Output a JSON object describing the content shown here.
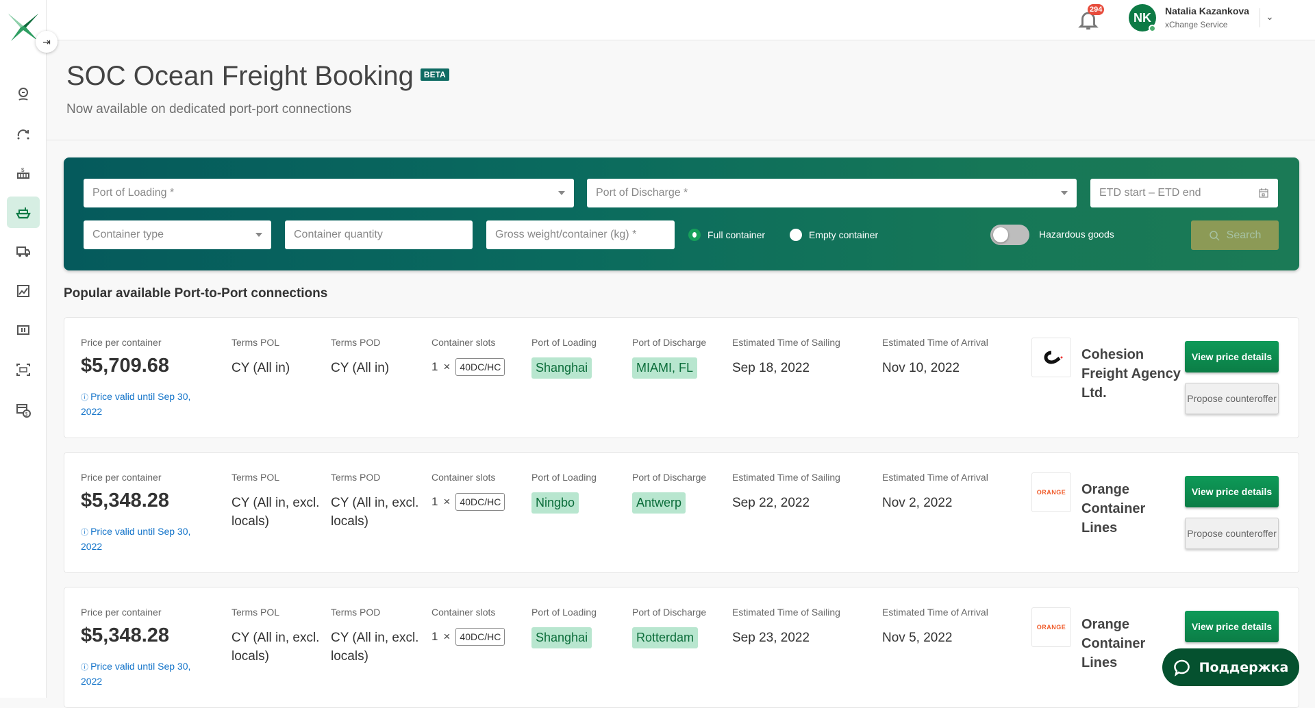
{
  "colors": {
    "brand": "#0d7a45",
    "panel_start": "#055a5c",
    "panel_end": "#1b7a56",
    "chip": "#b8e6cf",
    "link": "#1273c9"
  },
  "sidebar": {
    "items": [
      {
        "icon": "support-agent-icon"
      },
      {
        "icon": "route-icon"
      },
      {
        "icon": "container-price-icon"
      },
      {
        "icon": "ship-icon",
        "active": true
      },
      {
        "icon": "truck-icon"
      },
      {
        "icon": "analytics-icon"
      },
      {
        "icon": "container-icon"
      },
      {
        "icon": "container-scan-icon"
      },
      {
        "icon": "billing-icon"
      }
    ]
  },
  "header": {
    "notifications": "294",
    "user_initials": "NK",
    "user_name": "Natalia Kazankova",
    "user_role": "xChange Service"
  },
  "page": {
    "title": "SOC Ocean Freight Booking",
    "badge": "BETA",
    "subtitle": "Now available on dedicated port-port connections"
  },
  "search": {
    "port_loading": "Port of Loading *",
    "port_discharge": "Port of Discharge *",
    "etd": "ETD start – ETD end",
    "container_type": "Container type",
    "container_quantity": "Container quantity",
    "gross_weight": "Gross weight/container (kg) *",
    "full_container": "Full container",
    "empty_container": "Empty container",
    "selected": "Full container",
    "hazardous": "Hazardous goods",
    "hazardous_on": false,
    "search_label": "Search"
  },
  "section_title": "Popular available Port-to-Port connections",
  "labels": {
    "price": "Price per container",
    "terms_pol": "Terms POL",
    "terms_pod": "Terms POD",
    "slots": "Container slots",
    "pol": "Port of Loading",
    "pod": "Port of Discharge",
    "ets": "Estimated Time of Sailing",
    "eta": "Estimated Time of Arrival",
    "view": "View price details",
    "propose": "Propose counteroffer",
    "times": "×"
  },
  "offers": [
    {
      "price": "$5,709.68",
      "valid": "Price valid until Sep 30, 2022",
      "terms_pol": "CY (All in)",
      "terms_pod": "CY (All in)",
      "qty": "1",
      "ctype": "40DC/HC",
      "pol": "Shanghai",
      "pod": "MIAMI, FL",
      "ets": "Sep 18, 2022",
      "eta": "Nov 10, 2022",
      "carrier": "Cohesion Freight Agency Ltd.",
      "logo": "C",
      "propose": true
    },
    {
      "price": "$5,348.28",
      "valid": "Price valid until Sep 30, 2022",
      "terms_pol": "CY (All in, excl. locals)",
      "terms_pod": "CY (All in, excl. locals)",
      "qty": "1",
      "ctype": "40DC/HC",
      "pol": "Ningbo",
      "pod": "Antwerp",
      "ets": "Sep 22, 2022",
      "eta": "Nov 2, 2022",
      "carrier": "Orange Container Lines",
      "logo": "ORANGE",
      "propose": true
    },
    {
      "price": "$5,348.28",
      "valid": "Price valid until Sep 30, 2022",
      "terms_pol": "CY (All in, excl. locals)",
      "terms_pod": "CY (All in, excl. locals)",
      "qty": "1",
      "ctype": "40DC/HC",
      "pol": "Shanghai",
      "pod": "Rotterdam",
      "ets": "Sep 23, 2022",
      "eta": "Nov 5, 2022",
      "carrier": "Orange Container Lines",
      "logo": "ORANGE",
      "propose": false
    }
  ],
  "support_label": "Поддержка"
}
